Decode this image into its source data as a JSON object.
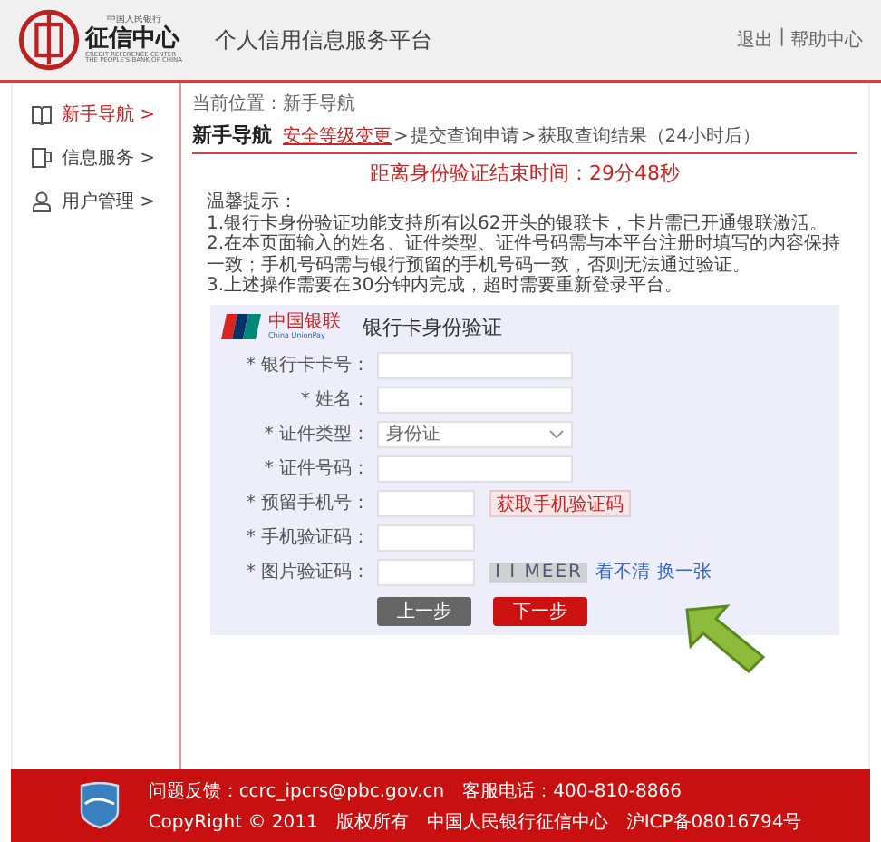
{
  "header": {
    "logo_top": "中国人民银行",
    "logo_name": "征信中心",
    "logo_en_1": "CREDIT REFERENCE CENTER",
    "logo_en_2": "THE PEOPLE'S BANK OF CHINA",
    "title": "个人信用信息服务平台",
    "links": [
      "退出",
      "帮助中心"
    ],
    "separator": "|"
  },
  "sidebar": {
    "items": [
      {
        "label": "新手导航 >",
        "kind": "guide",
        "selected": true
      },
      {
        "label": "信息服务 >",
        "kind": "service",
        "selected": false
      },
      {
        "label": "用户管理 >",
        "kind": "account",
        "selected": false
      }
    ]
  },
  "breadcrumb": "当前位置：新手导航",
  "section": {
    "title": "新手导航",
    "steps": [
      {
        "label": "安全等级变更",
        "selected": true
      },
      {
        "label": "提交查询申请",
        "selected": false
      },
      {
        "label": "获取查询结果（24小时后）",
        "selected": false
      }
    ],
    "step_separator": ">"
  },
  "timer": "距离身份验证结束时间：29分48秒",
  "notes": {
    "title": "温馨提示：",
    "items": [
      "1.银行卡身份验证功能支持所有以62开头的银联卡，卡片需已开通银联激活。",
      "2.在本页面输入的姓名、证件类型、证件号码需与本平台注册时填写的内容保持一致；手机号码需与银行预留的手机号码一致，否则无法通过验证。",
      "3.上述操作需要在30分钟内完成，超时需要重新登录平台。"
    ]
  },
  "form": {
    "brand_cn": "中国银联",
    "brand_en": "China UnionPay",
    "title": "银行卡身份验证",
    "fields": [
      {
        "kind": "text",
        "label": "* 银行卡卡号："
      },
      {
        "kind": "text",
        "label": "* 姓名："
      },
      {
        "kind": "select",
        "label": "* 证件类型：",
        "value": "身份证"
      },
      {
        "kind": "text",
        "label": "* 证件号码："
      },
      {
        "kind": "sms",
        "label": "* 预留手机号：",
        "button": "获取手机验证码"
      },
      {
        "kind": "short",
        "label": "* 手机验证码："
      },
      {
        "kind": "captcha",
        "label": "* 图片验证码：",
        "captcha": "I I MEER",
        "links": [
          "看不清",
          "换一张"
        ]
      }
    ],
    "buttons": [
      {
        "label": "上一步",
        "kind": "back"
      },
      {
        "label": "下一步",
        "kind": "next"
      }
    ]
  },
  "footer": {
    "lines": [
      "问题反馈：ccrc_ipcrs@pbc.gov.cn　客服电话：400-810-8866",
      "CopyRight © 2011　版权所有　中国人民银行征信中心　沪ICP备08016794号"
    ]
  }
}
